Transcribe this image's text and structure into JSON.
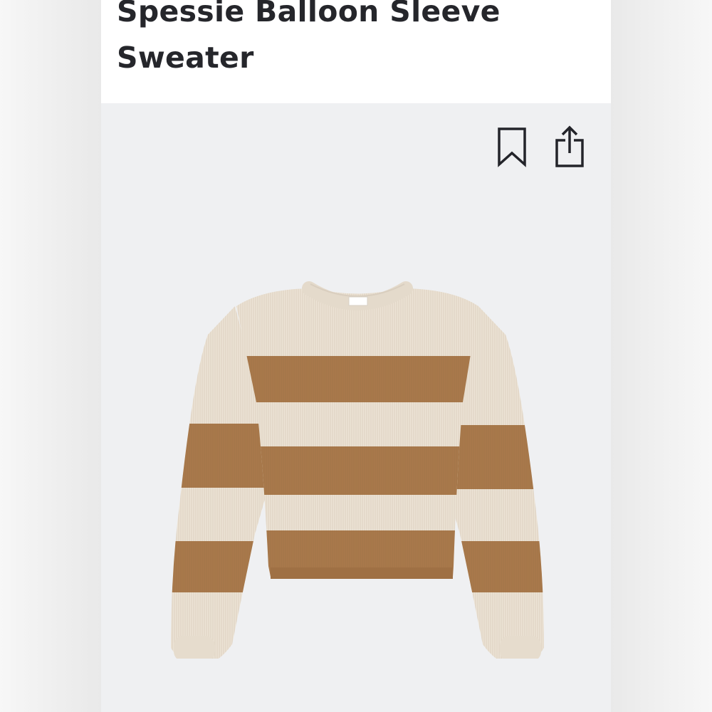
{
  "product": {
    "title": "Spessie Balloon Sleeve Sweater"
  },
  "actions": {
    "bookmark_icon": "bookmark-icon",
    "share_icon": "share-icon"
  },
  "colors": {
    "title_text": "#25262b",
    "image_background": "#eff0f2",
    "sweater_cream": "#ece3d5",
    "sweater_brown": "#a9794b",
    "icon_stroke": "#23242a"
  }
}
